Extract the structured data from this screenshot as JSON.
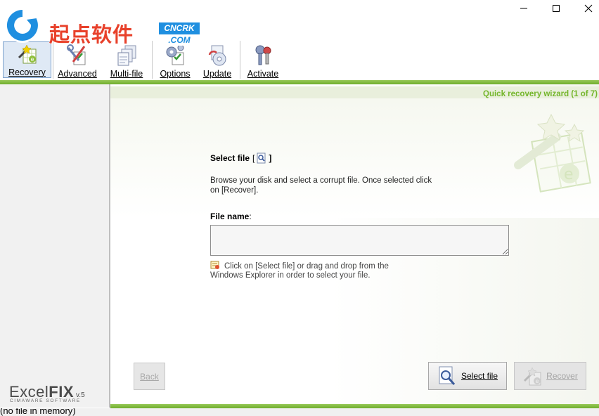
{
  "watermark": {
    "chinese_text": "起点软件",
    "badge_top": "CNCRK",
    "badge_bottom": ".COM"
  },
  "toolbar": {
    "recovery": "Recovery",
    "advanced": "Advanced",
    "multifile": "Multi-file",
    "options": "Options",
    "update": "Update",
    "activate": "Activate"
  },
  "wizard": {
    "title": "Quick recovery wizard (1 of 7)",
    "select_file_title": "Select file",
    "bracket_open": "[",
    "bracket_close": "]",
    "description": "Browse your disk and select a corrupt file. Once selected click on [Recover].",
    "file_name_label": "File name",
    "file_name_colon": ":",
    "file_name_value": "",
    "hint": "Click on [Select file] or drag and drop from the Windows Explorer in order to select your file."
  },
  "buttons": {
    "back": "Back",
    "select_file": "Select file",
    "recover": "Recover"
  },
  "brand": {
    "name_light": "Excel",
    "name_bold": "FIX",
    "version": "v.5",
    "company": "CIMAWARE SOFTWARE"
  },
  "status": {
    "text": "(no file in memory)"
  },
  "colors": {
    "accent_green": "#74b62b",
    "bar_green": "#6fae2c",
    "watermark_red": "#e8412b",
    "watermark_blue": "#1f8fe0"
  }
}
